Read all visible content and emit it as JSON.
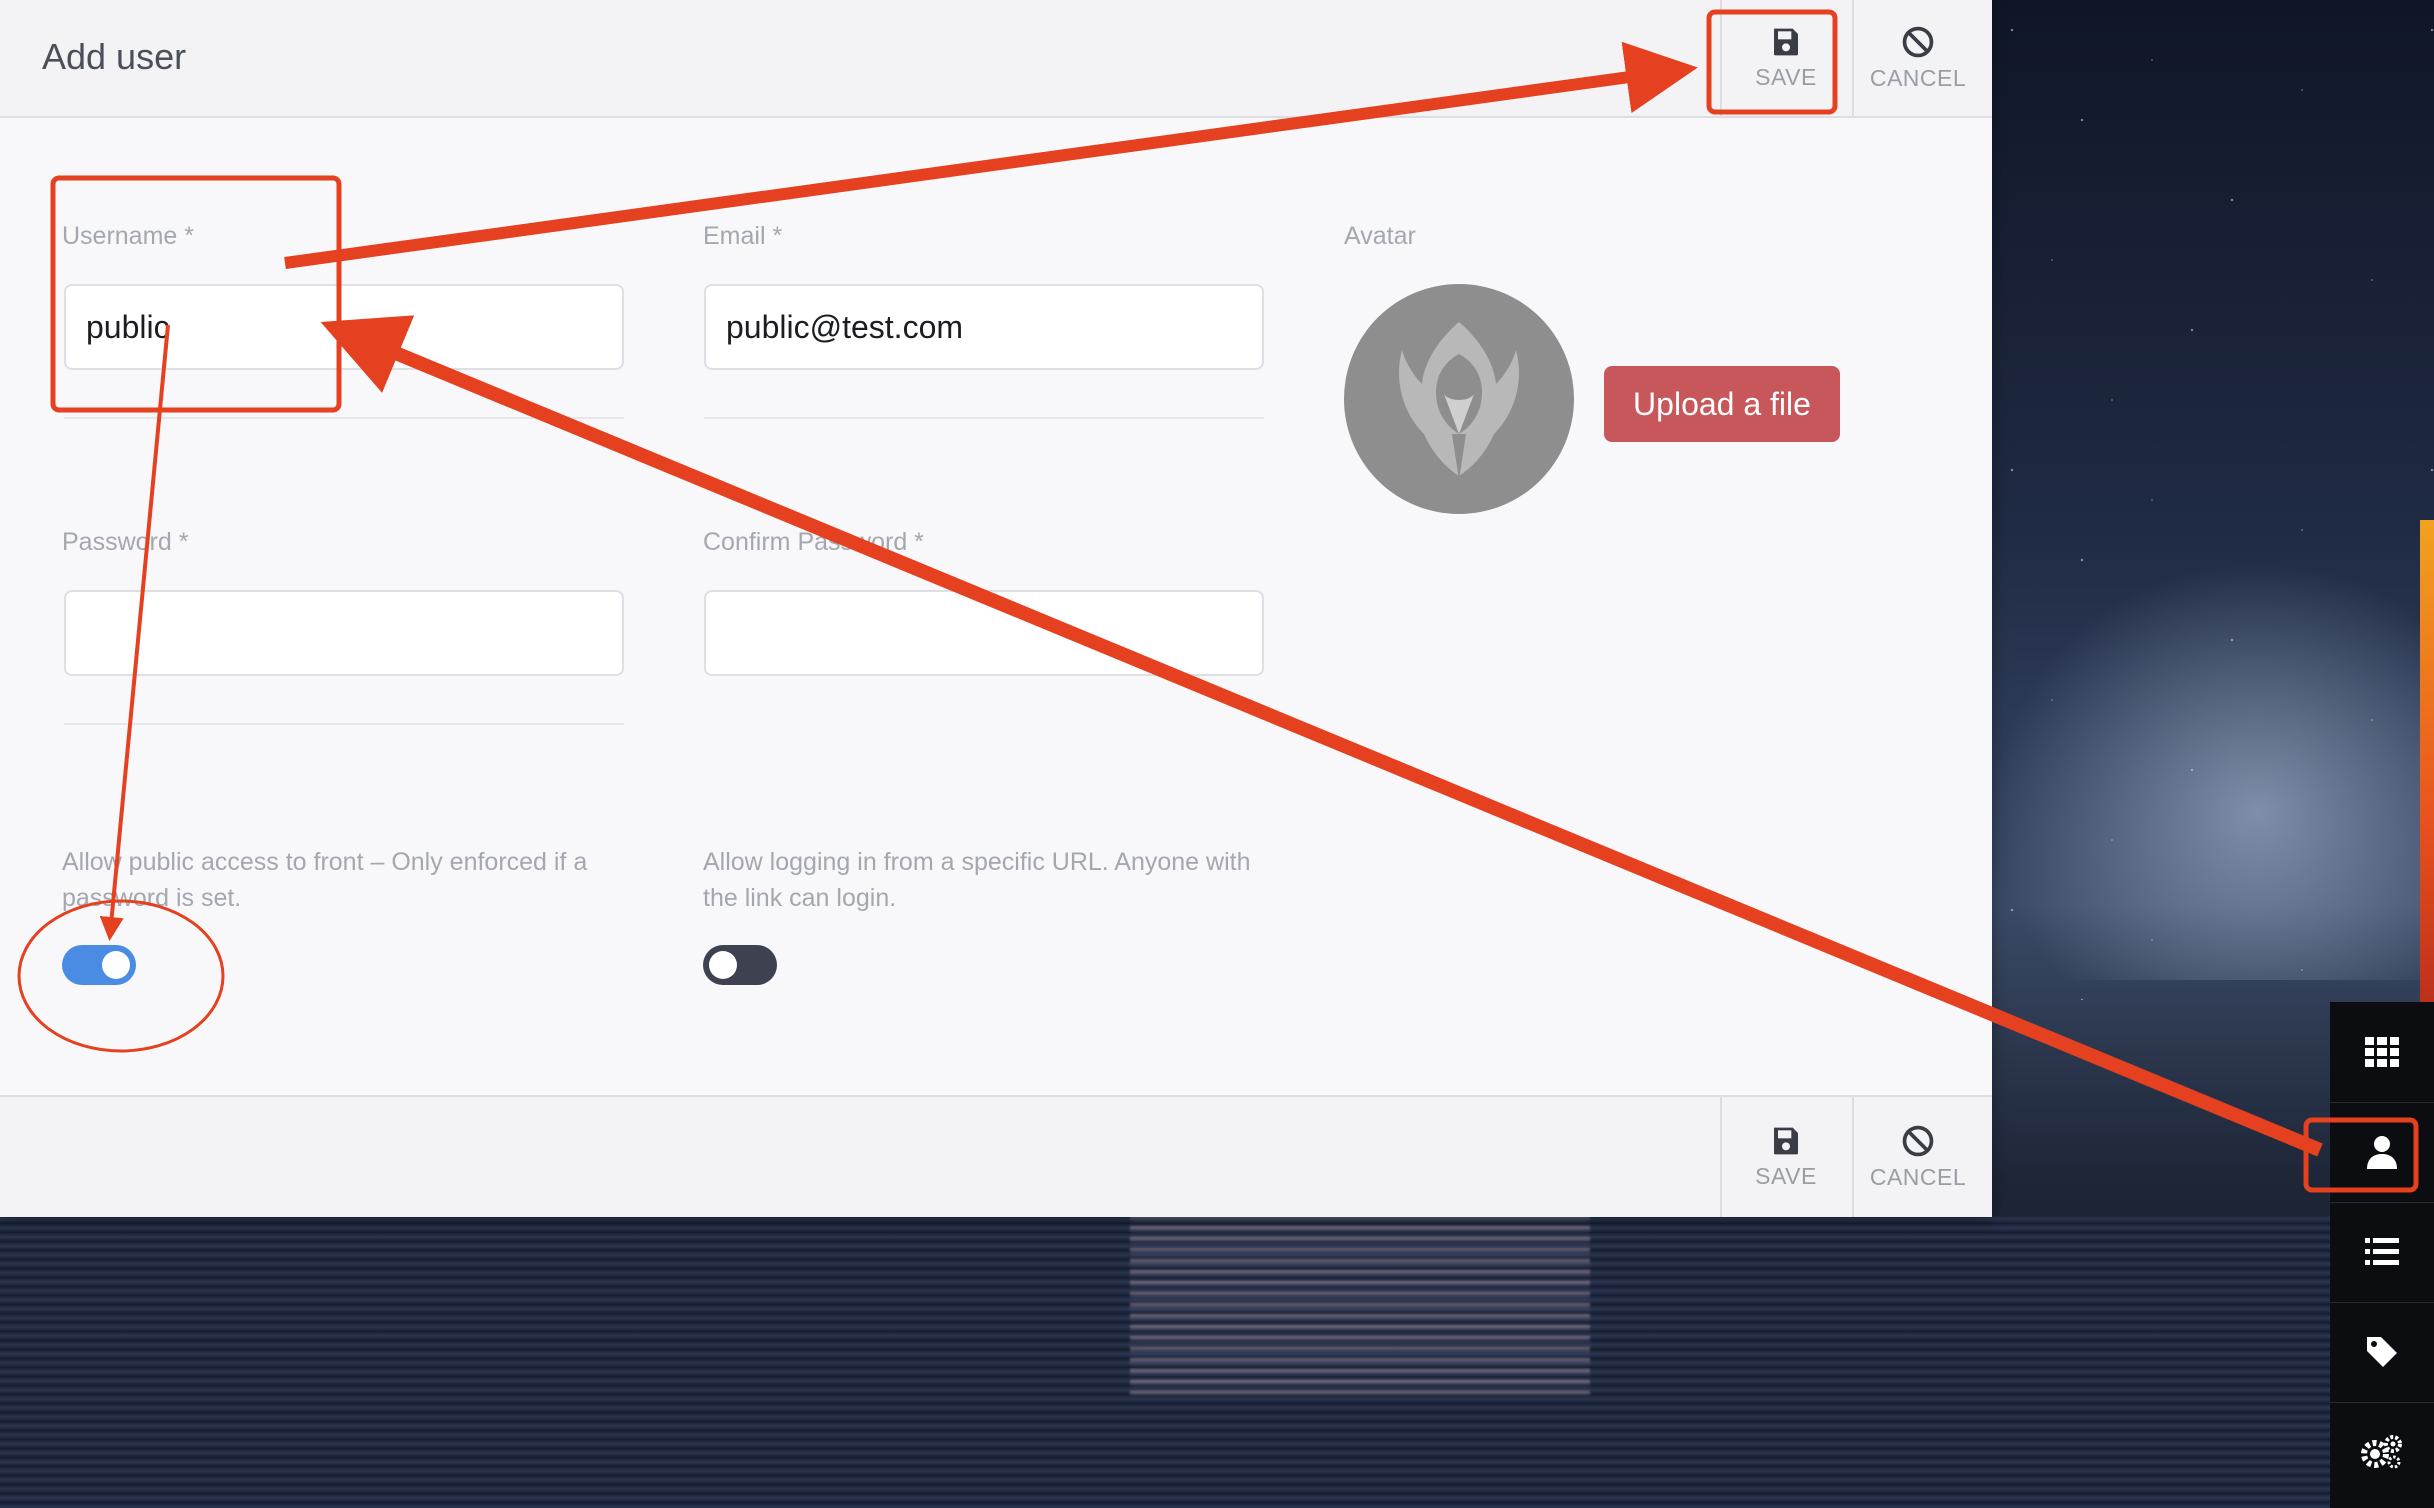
{
  "dialog": {
    "title": "Add user",
    "save_label": "SAVE",
    "cancel_label": "CANCEL"
  },
  "form": {
    "username": {
      "label": "Username *",
      "value": "public"
    },
    "email": {
      "label": "Email *",
      "value": "public@test.com"
    },
    "avatar": {
      "label": "Avatar",
      "upload_label": "Upload a file"
    },
    "password": {
      "label": "Password *",
      "value": ""
    },
    "confirm_password": {
      "label": "Confirm Password *",
      "value": ""
    },
    "public_access": {
      "help": "Allow public access to front – Only enforced if a password is set.",
      "enabled": true
    },
    "url_login": {
      "help": "Allow logging in from a specific URL. Anyone with the link can login.",
      "enabled": false
    }
  },
  "sidebar": {
    "items": [
      {
        "icon": "grid-icon"
      },
      {
        "icon": "user-icon",
        "highlighted": true
      },
      {
        "icon": "list-icon"
      },
      {
        "icon": "tag-icon"
      },
      {
        "icon": "gears-icon"
      }
    ]
  },
  "colors": {
    "annotation": "#e5401f",
    "toggle_on": "#4a8be3",
    "toggle_off": "#3d4150",
    "upload_button": "#c8575c"
  }
}
